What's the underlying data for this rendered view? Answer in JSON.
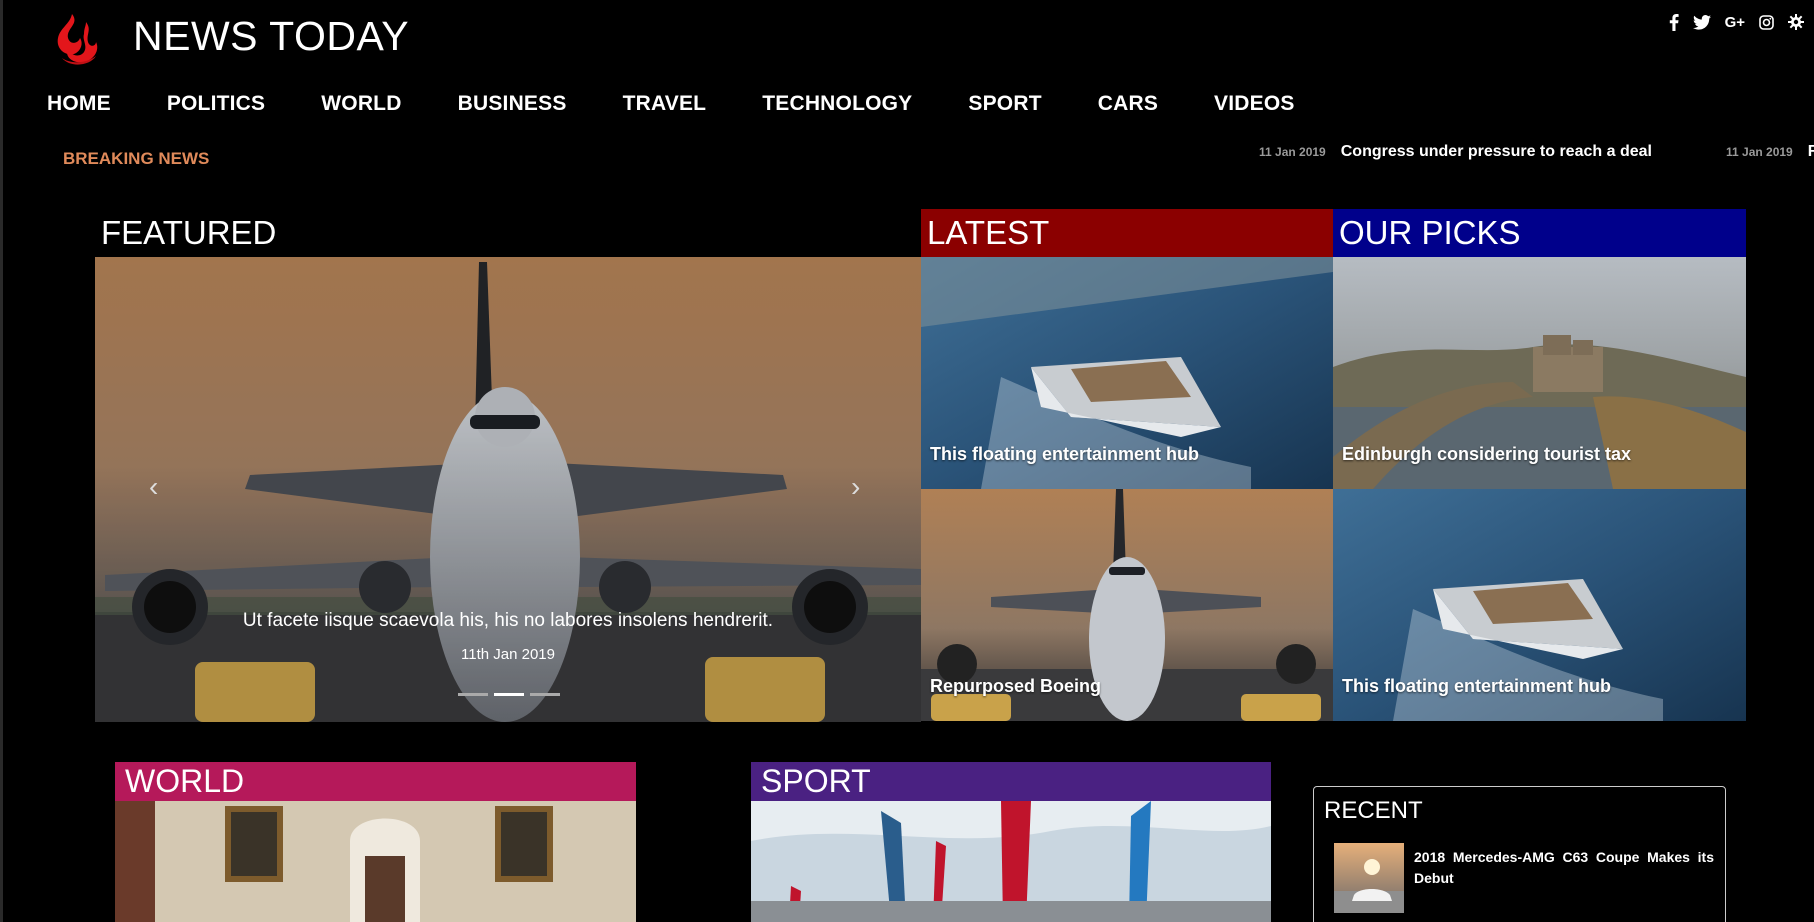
{
  "site": {
    "title": "NEWS TODAY"
  },
  "social": [
    "facebook-icon",
    "twitter-icon",
    "google-plus-icon",
    "instagram-icon",
    "settings-icon"
  ],
  "nav": [
    {
      "label": "HOME"
    },
    {
      "label": "POLITICS"
    },
    {
      "label": "WORLD"
    },
    {
      "label": "BUSINESS"
    },
    {
      "label": "TRAVEL"
    },
    {
      "label": "TECHNOLOGY"
    },
    {
      "label": "SPORT"
    },
    {
      "label": "CARS"
    },
    {
      "label": "VIDEOS"
    }
  ],
  "breaking": {
    "label": "BREAKING NEWS",
    "items": [
      {
        "date": "11 Jan 2019",
        "headline": "Congress under pressure to reach a deal"
      },
      {
        "date": "11 Jan 2019",
        "headline": "R"
      }
    ]
  },
  "featured": {
    "heading": "FEATURED",
    "caption": "Ut facete iisque scaevola his, his no labores insolens hendrerit.",
    "date": "11th Jan 2019",
    "indicators": 3,
    "active_indicator": 1
  },
  "latest": {
    "heading": "LATEST",
    "color": "#8b0000",
    "items": [
      {
        "title": "This floating entertainment hub"
      },
      {
        "title": "Repurposed Boeing"
      }
    ]
  },
  "picks": {
    "heading": "OUR PICKS",
    "color": "#00008b",
    "items": [
      {
        "title": "Edinburgh considering tourist tax"
      },
      {
        "title": "This floating entertainment hub"
      }
    ]
  },
  "world": {
    "heading": "WORLD",
    "color": "#b5195a"
  },
  "sport": {
    "heading": "SPORT",
    "color": "#4a2182"
  },
  "recent": {
    "heading": "RECENT",
    "items": [
      {
        "title": "2018 Mercedes-AMG C63 Coupe Makes its Debut"
      }
    ]
  },
  "colors": {
    "breaking": "#e08a5a",
    "background": "#000000"
  }
}
